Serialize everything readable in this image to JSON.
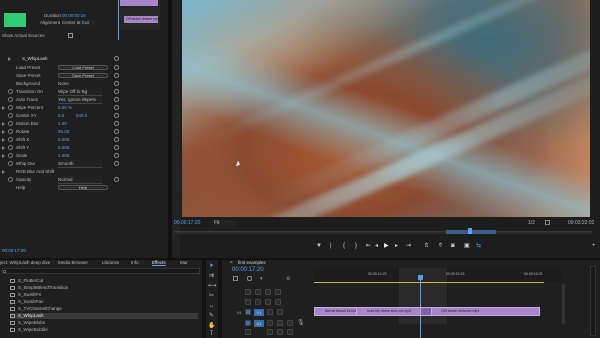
{
  "effect_controls": {
    "duration_label": "Duration",
    "duration_value": "00:00:00:16",
    "alignment_label": "Alignment",
    "alignment_value": "Center at Cut",
    "show_actual_sources": "Show Actual Sources",
    "effect_name": "S_WhipLash",
    "load_preset": "Load Preset",
    "load_preset_btn": "Load Preset",
    "save_preset": "Save Preset",
    "save_preset_btn": "Save Preset",
    "background_label": "Background",
    "background_value": "None",
    "transition_on_label": "Transition On",
    "transition_on_value": "Wipe Off to Bg",
    "auto_trans_label": "Auto Trans",
    "auto_trans_value": "Yes: Ignore Wipe%",
    "wipe_percent_label": "Wipe Percent",
    "wipe_percent_value": "0.00 %",
    "center_label": "Center XY",
    "center_x": "0.0",
    "center_y": "540.0",
    "motion_blur_label": "Motion Blur",
    "motion_blur_value": "1.00",
    "rotate_label": "Rotate",
    "rotate_value": "90.00",
    "shift_x_label": "Shift X",
    "shift_x_value": "0.000",
    "shift_y_label": "Shift Y",
    "shift_y_value": "0.000",
    "scale_label": "Scale",
    "scale_value": "1.000",
    "whip_out_label": "Whip Out",
    "whip_out_value": "Smooth",
    "rgb_blur_label": "RGB Blur And Shift",
    "opacity_label": "Opacity",
    "opacity_value": "Normal",
    "help_label": "Help",
    "help_btn": "Help",
    "clip_a": "...",
    "clip_b": "Off beach dslsee mp4",
    "timecode": "00:00:17:20"
  },
  "program": {
    "timecode": "00:00:17:20",
    "fit": "Fit",
    "fraction": "1/2",
    "duration": "00:03:22:02"
  },
  "project": {
    "tabs": [
      "ject: WhipLash deep dive",
      "Media Browser",
      "Libraries",
      "Info",
      "Effects",
      "Mar"
    ],
    "search_placeholder": "Ω",
    "items": [
      "S_FlutterCut",
      "S_SimpleBlendTransition",
      "S_SwishFX",
      "S_SwishPan",
      "S_TVChannelChange",
      "S_WhipLash",
      "S_WipeBlobs",
      "S_WipeBubble"
    ]
  },
  "timeline": {
    "sequence_tab": "first examples",
    "timecode": "00:00:17:20",
    "ruler": [
      "00:00:14:23",
      "00:00:15:23",
      "00:00:16:23"
    ],
    "tracks": [
      "V1",
      "A1"
    ],
    "clips": [
      "Bernal Beach Drone Spin.mp4",
      "road trip drone shot cut.mp4",
      "Cliff beach distance.mp4"
    ]
  },
  "colors": {
    "accent": "#5aa0f0",
    "clip": "#a887c8",
    "fx_thumb": "#2ecc71"
  }
}
